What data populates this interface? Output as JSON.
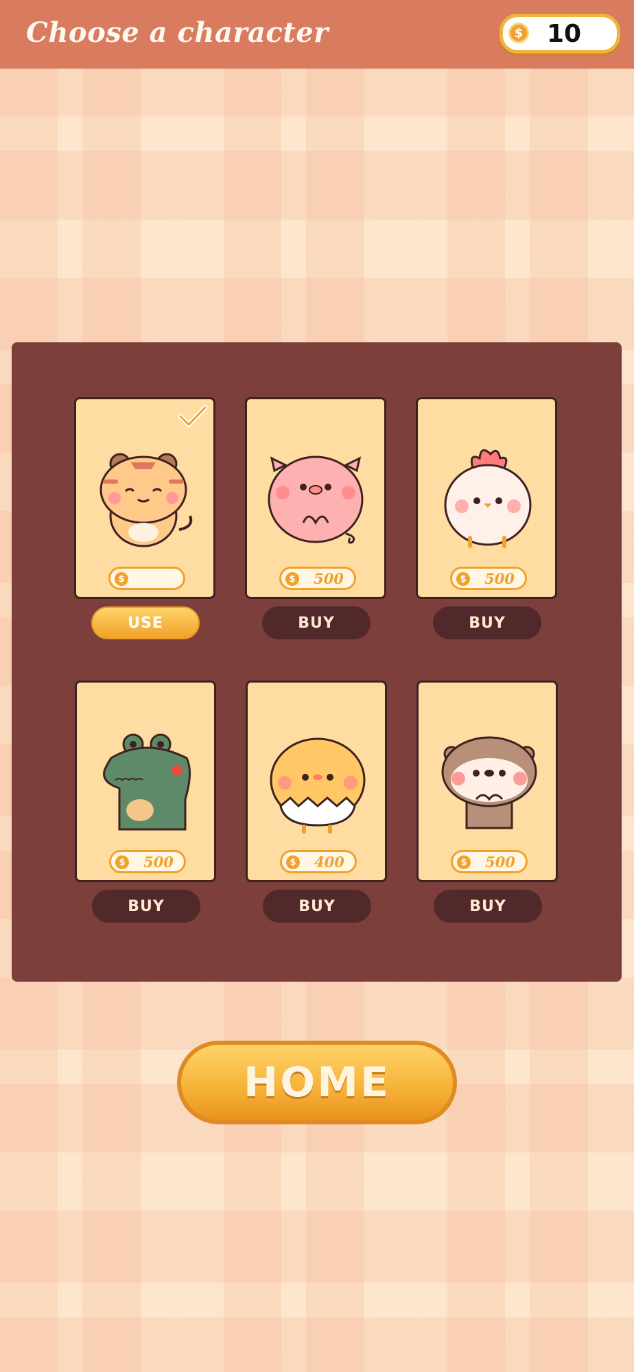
{
  "header": {
    "title": "Choose a character",
    "coin_count": "10",
    "coin_symbol": "$"
  },
  "characters": [
    {
      "name": "tiger",
      "price": "",
      "button": "USE",
      "selected": true
    },
    {
      "name": "pig",
      "price": "500",
      "button": "BUY",
      "selected": false
    },
    {
      "name": "chicken",
      "price": "500",
      "button": "BUY",
      "selected": false
    },
    {
      "name": "crocodile",
      "price": "500",
      "button": "BUY",
      "selected": false
    },
    {
      "name": "chick",
      "price": "400",
      "button": "BUY",
      "selected": false
    },
    {
      "name": "otter",
      "price": "500",
      "button": "BUY",
      "selected": false
    }
  ],
  "footer": {
    "home_label": "HOME"
  },
  "colors": {
    "header": "#d97b5f",
    "panel": "#7c3f3b",
    "card": "#ffdca2",
    "buy": "#52292a",
    "accent": "#f2a12a"
  }
}
